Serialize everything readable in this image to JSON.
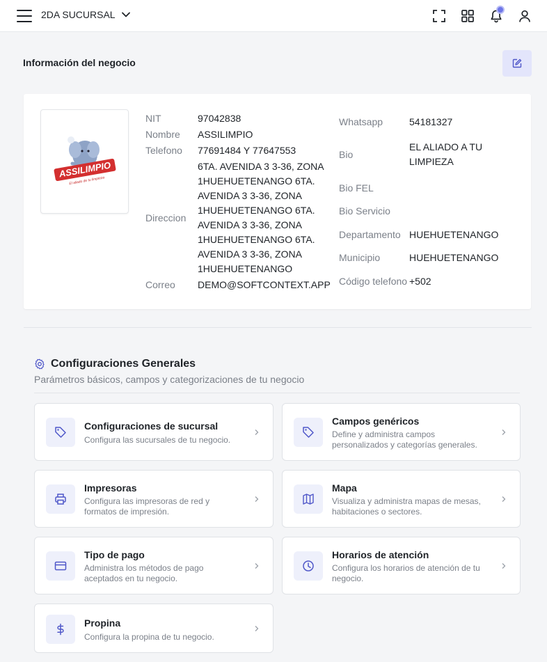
{
  "topbar": {
    "branch_label": "2DA SUCURSAL",
    "icons": [
      "menu-icon",
      "chevron-down-icon",
      "fullscreen-icon",
      "apps-grid-icon",
      "bell-icon",
      "user-icon"
    ]
  },
  "business": {
    "section_title": "Información del negocio",
    "logo_text": "ASSILIMPIO",
    "logo_tagline": "El aliado de tu limpieza",
    "left_fields": {
      "nit": {
        "label": "NIT",
        "value": "97042838"
      },
      "nombre": {
        "label": "Nombre",
        "value": "ASSILIMPIO"
      },
      "telefono": {
        "label": "Telefono",
        "value": "77691484 Y 77647553"
      },
      "direccion": {
        "label": "Direccion",
        "lines": [
          "6TA. AVENIDA 3 3-36, ZONA",
          "1HUEHUETENANGO 6TA.",
          "AVENIDA 3 3-36, ZONA",
          "1HUEHUETENANGO 6TA.",
          "AVENIDA 3 3-36, ZONA",
          "1HUEHUETENANGO 6TA.",
          "AVENIDA 3 3-36, ZONA",
          "1HUEHUETENANGO"
        ]
      },
      "correo": {
        "label": "Correo",
        "value": "DEMO@SOFTCONTEXT.APP"
      }
    },
    "right_fields": {
      "whatsapp": {
        "label": "Whatsapp",
        "value": "54181327"
      },
      "bio": {
        "label": "Bio",
        "lines": [
          "EL ALIADO A TU",
          "LIMPIEZA"
        ]
      },
      "bio_fel": {
        "label": "Bio FEL",
        "value": ""
      },
      "bio_servicio": {
        "label": "Bio Servicio",
        "value": ""
      },
      "departamento": {
        "label": "Departamento",
        "value": "HUEHUETENANGO"
      },
      "municipio": {
        "label": "Municipio",
        "value": "HUEHUETENANGO"
      },
      "codigo_telefono": {
        "label": "Código telefono",
        "value": "+502"
      }
    }
  },
  "config": {
    "title": "Configuraciones Generales",
    "subtitle": "Parámetros básicos, campos y categorizaciones de tu negocio",
    "tiles": [
      {
        "title": "Configuraciones de sucursal",
        "desc": "Configura las sucursales de tu negocio.",
        "icon": "tag-icon"
      },
      {
        "title": "Campos genéricos",
        "desc": "Define y administra campos personalizados y categorías generales.",
        "icon": "tag-icon"
      },
      {
        "title": "Impresoras",
        "desc": "Configura las impresoras de red y formatos de impresión.",
        "icon": "printer-icon"
      },
      {
        "title": "Mapa",
        "desc": "Visualiza y administra mapas de mesas, habitaciones o sectores.",
        "icon": "map-icon"
      },
      {
        "title": "Tipo de pago",
        "desc": "Administra los métodos de pago aceptados en tu negocio.",
        "icon": "credit-card-icon"
      },
      {
        "title": "Horarios de atención",
        "desc": "Configura los horarios de atención de tu negocio.",
        "icon": "clock-icon"
      },
      {
        "title": "Propina",
        "desc": "Configura la propina de tu negocio.",
        "icon": "dollar-icon"
      }
    ]
  },
  "colors": {
    "accent": "#6e76e8",
    "icon_tint": "#4f57c9",
    "tile_icon_bg": "#eef0fb",
    "page_bg": "#f4f5f7"
  }
}
